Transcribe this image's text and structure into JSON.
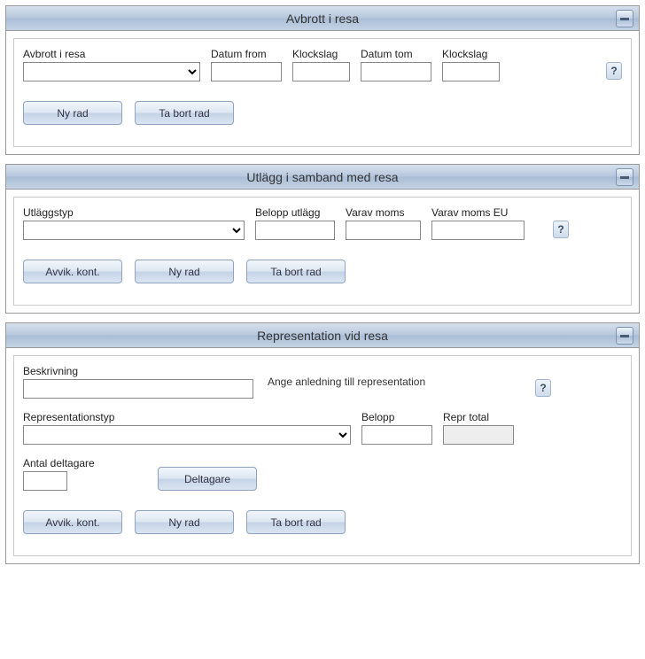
{
  "sections": {
    "avbrott": {
      "title": "Avbrott i resa",
      "labels": {
        "avbrott_i_resa": "Avbrott i resa",
        "datum_from": "Datum from",
        "klockslag1": "Klockslag",
        "datum_tom": "Datum tom",
        "klockslag2": "Klockslag"
      },
      "values": {
        "avbrott_i_resa": "",
        "datum_from": "",
        "klockslag1": "",
        "datum_tom": "",
        "klockslag2": ""
      },
      "buttons": {
        "ny_rad": "Ny rad",
        "ta_bort_rad": "Ta bort rad"
      },
      "help": "?"
    },
    "utlagg": {
      "title": "Utlägg i samband med resa",
      "labels": {
        "utlaggstyp": "Utläggstyp",
        "belopp_utlagg": "Belopp utlägg",
        "varav_moms": "Varav moms",
        "varav_moms_eu": "Varav moms EU"
      },
      "values": {
        "utlaggstyp": "",
        "belopp_utlagg": "",
        "varav_moms": "",
        "varav_moms_eu": ""
      },
      "buttons": {
        "avvik_kont": "Avvik. kont.",
        "ny_rad": "Ny rad",
        "ta_bort_rad": "Ta bort rad"
      },
      "help": "?"
    },
    "representation": {
      "title": "Representation vid resa",
      "labels": {
        "beskrivning": "Beskrivning",
        "ange_anledning": "Ange anledning till representation",
        "representationstyp": "Representationstyp",
        "belopp": "Belopp",
        "repr_total": "Repr total",
        "antal_deltagare": "Antal deltagare"
      },
      "values": {
        "beskrivning": "",
        "representationstyp": "",
        "belopp": "",
        "repr_total": "",
        "antal_deltagare": ""
      },
      "buttons": {
        "deltagare": "Deltagare",
        "avvik_kont": "Avvik. kont.",
        "ny_rad": "Ny rad",
        "ta_bort_rad": "Ta bort rad"
      },
      "help": "?"
    }
  }
}
